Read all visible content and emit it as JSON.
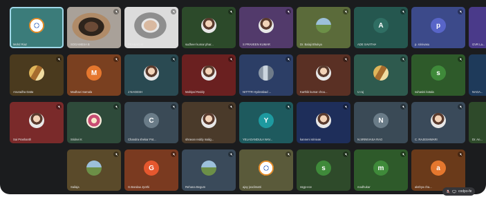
{
  "meeting": {
    "self_view_label": "codpo-fe",
    "tiles": [
      {
        "row": 0,
        "col": 0,
        "name": "Mohd Riaz",
        "bg": "#3b7c7a",
        "avatar": "chakra",
        "letter": "",
        "active": true
      },
      {
        "row": 0,
        "col": 1,
        "name": "SOGAMESA B",
        "bg": "#8a7a6a",
        "avatar": "video-woman",
        "letter": ""
      },
      {
        "row": 0,
        "col": 2,
        "name": "PRASAD M",
        "bg": "#5c5c5c",
        "avatar": "video-man",
        "letter": ""
      },
      {
        "row": 0,
        "col": 3,
        "name": "sudheer kumar phar...",
        "bg": "#2c4a2a",
        "avatar": "photo",
        "letter": ""
      },
      {
        "row": 0,
        "col": 4,
        "name": "S PRAVEEN KUMAR",
        "bg": "#523a6b",
        "avatar": "photo",
        "letter": ""
      },
      {
        "row": 0,
        "col": 5,
        "name": "Dr. Balaji Bhukya",
        "bg": "#5b6b3a",
        "avatar": "scene",
        "letter": ""
      },
      {
        "row": 0,
        "col": 6,
        "name": "ADE SAVITHA",
        "bg": "#25574f",
        "avatar": "letter",
        "letter": "A",
        "avatar_color": "#2f6e63"
      },
      {
        "row": 0,
        "col": 7,
        "name": "p. srinivasu",
        "bg": "#3c4a8a",
        "avatar": "letter",
        "letter": "p",
        "avatar_color": "#5865c8"
      },
      {
        "row": 0,
        "col": 8,
        "name": "GVR La...",
        "bg": "#4a3a8a",
        "avatar": "none",
        "letter": ""
      },
      {
        "row": 1,
        "col": 0,
        "name": "Anuradha Datta",
        "bg": "#4a3a1e",
        "avatar": "group",
        "letter": ""
      },
      {
        "row": 1,
        "col": 1,
        "name": "Madhavi Samala",
        "bg": "#7a4020",
        "avatar": "letter",
        "letter": "M",
        "avatar_color": "#e5772e"
      },
      {
        "row": 1,
        "col": 2,
        "name": "J NAGESH",
        "bg": "#2a4a52",
        "avatar": "photo",
        "letter": ""
      },
      {
        "row": 1,
        "col": 3,
        "name": "Mahipal Reddy",
        "bg": "#6a2020",
        "avatar": "photo",
        "letter": ""
      },
      {
        "row": 1,
        "col": 4,
        "name": "NITTTR Hyderabad ...",
        "bg": "#2c3e66",
        "avatar": "bldg",
        "letter": ""
      },
      {
        "row": 1,
        "col": 5,
        "name": "Karthik kumar chou...",
        "bg": "#5a3024",
        "avatar": "photo",
        "letter": ""
      },
      {
        "row": 1,
        "col": 6,
        "name": "U raj",
        "bg": "#2e5a4e",
        "avatar": "group",
        "letter": ""
      },
      {
        "row": 1,
        "col": 7,
        "name": "suhasini kotala",
        "bg": "#2e5a2a",
        "avatar": "letter",
        "letter": "s",
        "avatar_color": "#3f8a3a"
      },
      {
        "row": 1,
        "col": 8,
        "name": "NAGA...",
        "bg": "#1e3a5a",
        "avatar": "none",
        "letter": ""
      },
      {
        "row": 2,
        "col": 0,
        "name": "Sai Prashanth",
        "bg": "#7a2a2a",
        "avatar": "photo",
        "letter": ""
      },
      {
        "row": 2,
        "col": 1,
        "name": "Sridevi K",
        "bg": "#2e4a3a",
        "avatar": "flower",
        "letter": ""
      },
      {
        "row": 2,
        "col": 2,
        "name": "Chandra shekar Pot...",
        "bg": "#3a4a56",
        "avatar": "letter",
        "letter": "C",
        "avatar_color": "#6a7c88"
      },
      {
        "row": 2,
        "col": 3,
        "name": "shravan reddy malig...",
        "bg": "#4a3a2a",
        "avatar": "photo",
        "letter": ""
      },
      {
        "row": 2,
        "col": 4,
        "name": "YELAGANDULA NAV...",
        "bg": "#1e5a5e",
        "avatar": "letter",
        "letter": "Y",
        "avatar_color": "#1e9aa0"
      },
      {
        "row": 2,
        "col": 5,
        "name": "kanneni srinivas",
        "bg": "#1e2e5a",
        "avatar": "photo",
        "letter": ""
      },
      {
        "row": 2,
        "col": 6,
        "name": "N.SRINIVASA RAO",
        "bg": "#3a4a56",
        "avatar": "letter",
        "letter": "N",
        "avatar_color": "#6a7c88"
      },
      {
        "row": 2,
        "col": 7,
        "name": "C. RAJESHWARI",
        "bg": "#3a4a5a",
        "avatar": "photo",
        "letter": ""
      },
      {
        "row": 2,
        "col": 8,
        "name": "Dr. An...",
        "bg": "#2e4a2a",
        "avatar": "none",
        "letter": ""
      },
      {
        "row": 3,
        "col": 1,
        "name": "Sailaja",
        "bg": "#5a4a2a",
        "avatar": "scene",
        "letter": ""
      },
      {
        "row": 3,
        "col": 2,
        "name": "G.Bandaa Jyothi",
        "bg": "#7a3a20",
        "avatar": "letter",
        "letter": "G",
        "avatar_color": "#e5572e"
      },
      {
        "row": 3,
        "col": 3,
        "name": "Rehana Begum",
        "bg": "#3a4a5a",
        "avatar": "scene",
        "letter": ""
      },
      {
        "row": 3,
        "col": 4,
        "name": "ajay joodimatti",
        "bg": "#5a5a3a",
        "avatar": "chakra",
        "letter": ""
      },
      {
        "row": 3,
        "col": 5,
        "name": "ssgp-ece",
        "bg": "#2e4a2a",
        "avatar": "letter",
        "letter": "s",
        "avatar_color": "#3f8a3a"
      },
      {
        "row": 3,
        "col": 6,
        "name": "madhukar",
        "bg": "#2e5a2a",
        "avatar": "letter",
        "letter": "m",
        "avatar_color": "#3f8a3a"
      },
      {
        "row": 3,
        "col": 7,
        "name": "akshya cha...",
        "bg": "#6a3a1a",
        "avatar": "letter",
        "letter": "a",
        "avatar_color": "#e5772e"
      }
    ]
  },
  "colors": {
    "meeting_bg": "#1b1c1e",
    "muted_badge": "#5f6368",
    "active_outline": "#9fd7e8"
  }
}
